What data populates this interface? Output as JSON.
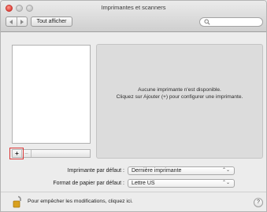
{
  "window": {
    "title": "Imprimantes et scanners"
  },
  "toolbar": {
    "back_icon": "chevron-left-icon",
    "forward_icon": "chevron-right-icon",
    "show_all_label": "Tout afficher",
    "search_placeholder": "",
    "search_icon": "search-icon"
  },
  "printers_list": {
    "items": [],
    "add_label": "+",
    "remove_label": "−"
  },
  "detail": {
    "message_line1": "Aucune imprimante n'est disponible.",
    "message_line2": "Cliquez sur Ajouter (+) pour configurer une imprimante."
  },
  "settings": {
    "default_printer_label": "Imprimante par défaut :",
    "default_printer_value": "Dernière imprimante",
    "paper_format_label": "Format de papier par défaut :",
    "paper_format_value": "Lettre US",
    "popup_arrows": "⌃⌄"
  },
  "footer": {
    "lock_icon": "unlocked-padlock-icon",
    "lock_text": "Pour empêcher les modifications, cliquez ici.",
    "help_label": "?"
  },
  "colors": {
    "highlight": "#d93636",
    "close_button": "#e0443e"
  }
}
